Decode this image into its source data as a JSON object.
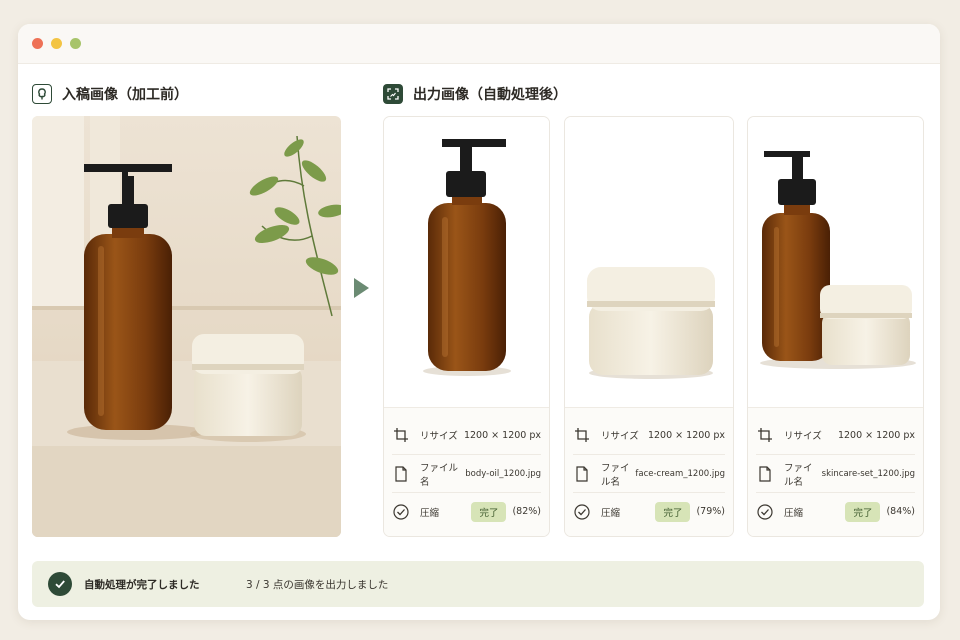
{
  "window": {
    "controls": [
      "close",
      "minimize",
      "maximize"
    ]
  },
  "input_section": {
    "title": "入稿画像（加工前）",
    "icon": "image-icon"
  },
  "output_section": {
    "title": "出力画像（自動処理後）",
    "icon": "auto-crop-icon"
  },
  "outputs": [
    {
      "product": "amber-pump-bottle",
      "rows": [
        {
          "icon": "crop-icon",
          "label": "リサイズ",
          "value": "1200 × 1200 px"
        },
        {
          "icon": "file-icon",
          "label": "ファイル名",
          "value": "body-oil_1200.jpg"
        },
        {
          "icon": "check-circle-icon",
          "label": "圧縮",
          "badge": "完了",
          "value": "(82%)"
        }
      ]
    },
    {
      "product": "cream-jar",
      "rows": [
        {
          "icon": "crop-icon",
          "label": "リサイズ",
          "value": "1200 × 1200 px"
        },
        {
          "icon": "file-icon",
          "label": "ファイル名",
          "value": "face-cream_1200.jpg"
        },
        {
          "icon": "check-circle-icon",
          "label": "圧縮",
          "badge": "完了",
          "value": "(79%)"
        }
      ]
    },
    {
      "product": "skincare-set",
      "rows": [
        {
          "icon": "crop-icon",
          "label": "リサイズ",
          "value": "1200 × 1200 px"
        },
        {
          "icon": "file-icon",
          "label": "ファイル名",
          "value": "skincare-set_1200.jpg"
        },
        {
          "icon": "check-circle-icon",
          "label": "圧縮",
          "badge": "完了",
          "value": "(84%)"
        }
      ]
    }
  ],
  "status": {
    "icon": "check-icon",
    "message": "自動処理が完了しました",
    "detail": "3 / 3 点の画像を出力しました"
  },
  "colors": {
    "accent": "#2e4a37",
    "badge_bg": "#d7e4b7",
    "status_bg": "#eef0e2",
    "amber": "#8a4a14"
  }
}
